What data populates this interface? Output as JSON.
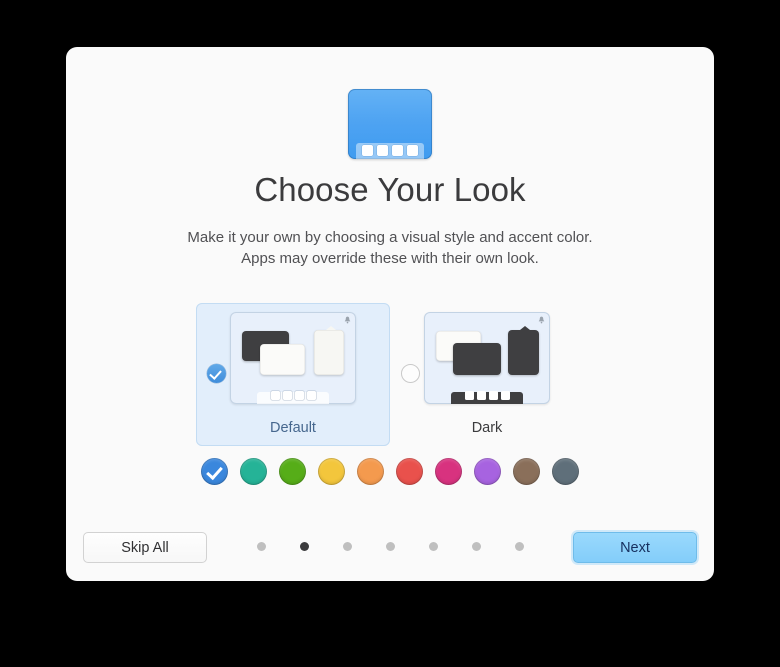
{
  "window": {
    "title": "Choose Your Look",
    "subtitle_line1": "Make it your own by choosing a visual style and accent color.",
    "subtitle_line2": "Apps may override these with their own look.",
    "hero_icon": "desktop-dock-icon"
  },
  "themes": [
    {
      "id": "default",
      "label": "Default",
      "selected": true
    },
    {
      "id": "dark",
      "label": "Dark",
      "selected": false
    }
  ],
  "accents": [
    {
      "name": "blue",
      "color": "#3a87dd",
      "selected": true
    },
    {
      "name": "teal",
      "color": "#25b397",
      "selected": false
    },
    {
      "name": "green",
      "color": "#56ad18",
      "selected": false
    },
    {
      "name": "yellow",
      "color": "#f3c63c",
      "selected": false
    },
    {
      "name": "orange",
      "color": "#f49a4e",
      "selected": false
    },
    {
      "name": "red",
      "color": "#e9514c",
      "selected": false
    },
    {
      "name": "pink",
      "color": "#d8327f",
      "selected": false
    },
    {
      "name": "purple",
      "color": "#a763e0",
      "selected": false
    },
    {
      "name": "brown",
      "color": "#8a6f5a",
      "selected": false
    },
    {
      "name": "graphite",
      "color": "#5f6f7a",
      "selected": false
    }
  ],
  "footer": {
    "skip_label": "Skip All",
    "next_label": "Next",
    "dots_total": 7,
    "dots_active_index": 1
  }
}
